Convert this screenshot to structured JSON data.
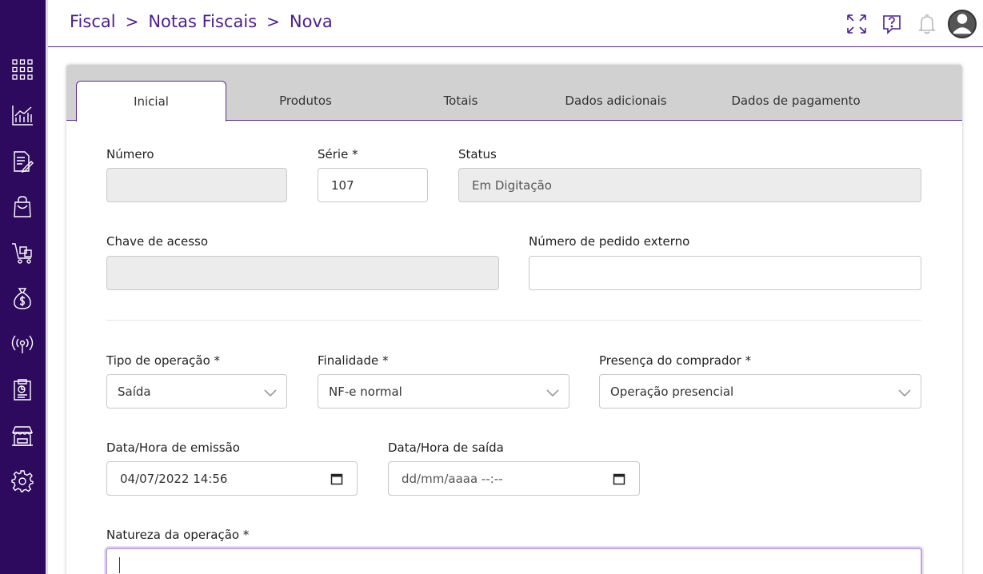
{
  "sidebar": {
    "items": [
      {
        "icon": "grid-icon"
      },
      {
        "icon": "chart-icon"
      },
      {
        "icon": "document-edit-icon"
      },
      {
        "icon": "shopping-bag-icon"
      },
      {
        "icon": "cart-icon"
      },
      {
        "icon": "money-bag-icon"
      },
      {
        "icon": "broadcast-icon"
      },
      {
        "icon": "report-icon"
      },
      {
        "icon": "store-icon"
      },
      {
        "icon": "settings-icon"
      }
    ]
  },
  "breadcrumb": {
    "items": [
      "Fiscal",
      "Notas Fiscais",
      "Nova"
    ],
    "separator": ">"
  },
  "header_icons": [
    "fullscreen-icon",
    "help-icon",
    "bell-icon",
    "avatar"
  ],
  "tabs": [
    {
      "label": "Inicial",
      "active": true
    },
    {
      "label": "Produtos",
      "active": false
    },
    {
      "label": "Totais",
      "active": false
    },
    {
      "label": "Dados adicionais",
      "active": false
    },
    {
      "label": "Dados de pagamento",
      "active": false
    }
  ],
  "form": {
    "numero": {
      "label": "Número",
      "value": ""
    },
    "serie": {
      "label": "Série *",
      "value": "107"
    },
    "status": {
      "label": "Status",
      "value": "Em Digitação"
    },
    "chave": {
      "label": "Chave de acesso",
      "value": ""
    },
    "pedido_externo": {
      "label": "Número de pedido externo",
      "value": ""
    },
    "tipo_operacao": {
      "label": "Tipo de operação *",
      "value": "Saída"
    },
    "finalidade": {
      "label": "Finalidade *",
      "value": "NF-e normal"
    },
    "presenca": {
      "label": "Presença do comprador *",
      "value": "Operação presencial"
    },
    "data_emissao": {
      "label": "Data/Hora de emissão",
      "value": "04/07/2022 14:56"
    },
    "data_saida": {
      "label": "Data/Hora de saída",
      "value": "dd/mm/aaaa --:--"
    },
    "natureza": {
      "label": "Natureza da operação *",
      "value": ""
    }
  },
  "colors": {
    "sidebar_bg": "#2d0a5e",
    "accent": "#4b1d90",
    "tabbar_bg": "#d1d1d1",
    "disabled_bg": "#ececec"
  }
}
